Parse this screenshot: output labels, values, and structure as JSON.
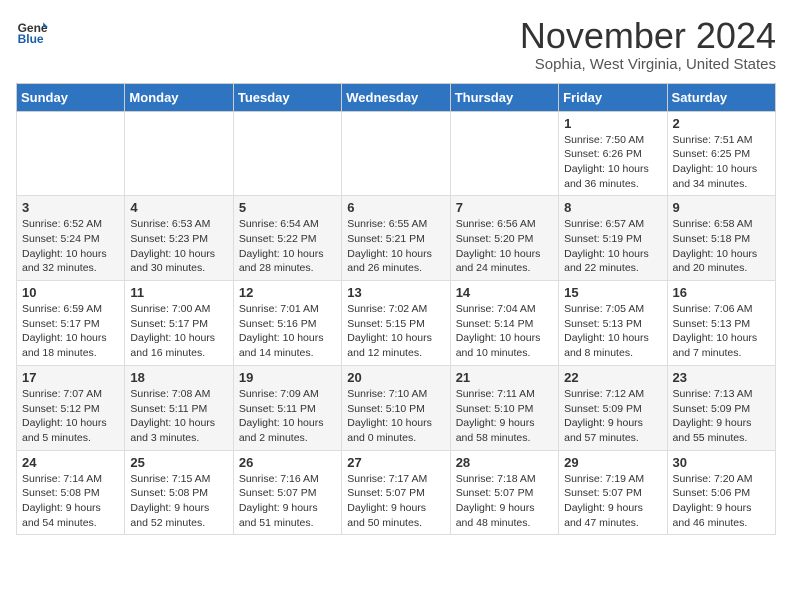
{
  "logo": {
    "general": "General",
    "blue": "Blue"
  },
  "title": "November 2024",
  "subtitle": "Sophia, West Virginia, United States",
  "days_of_week": [
    "Sunday",
    "Monday",
    "Tuesday",
    "Wednesday",
    "Thursday",
    "Friday",
    "Saturday"
  ],
  "weeks": [
    [
      {
        "day": "",
        "info": ""
      },
      {
        "day": "",
        "info": ""
      },
      {
        "day": "",
        "info": ""
      },
      {
        "day": "",
        "info": ""
      },
      {
        "day": "",
        "info": ""
      },
      {
        "day": "1",
        "info": "Sunrise: 7:50 AM\nSunset: 6:26 PM\nDaylight: 10 hours and 36 minutes."
      },
      {
        "day": "2",
        "info": "Sunrise: 7:51 AM\nSunset: 6:25 PM\nDaylight: 10 hours and 34 minutes."
      }
    ],
    [
      {
        "day": "3",
        "info": "Sunrise: 6:52 AM\nSunset: 5:24 PM\nDaylight: 10 hours and 32 minutes."
      },
      {
        "day": "4",
        "info": "Sunrise: 6:53 AM\nSunset: 5:23 PM\nDaylight: 10 hours and 30 minutes."
      },
      {
        "day": "5",
        "info": "Sunrise: 6:54 AM\nSunset: 5:22 PM\nDaylight: 10 hours and 28 minutes."
      },
      {
        "day": "6",
        "info": "Sunrise: 6:55 AM\nSunset: 5:21 PM\nDaylight: 10 hours and 26 minutes."
      },
      {
        "day": "7",
        "info": "Sunrise: 6:56 AM\nSunset: 5:20 PM\nDaylight: 10 hours and 24 minutes."
      },
      {
        "day": "8",
        "info": "Sunrise: 6:57 AM\nSunset: 5:19 PM\nDaylight: 10 hours and 22 minutes."
      },
      {
        "day": "9",
        "info": "Sunrise: 6:58 AM\nSunset: 5:18 PM\nDaylight: 10 hours and 20 minutes."
      }
    ],
    [
      {
        "day": "10",
        "info": "Sunrise: 6:59 AM\nSunset: 5:17 PM\nDaylight: 10 hours and 18 minutes."
      },
      {
        "day": "11",
        "info": "Sunrise: 7:00 AM\nSunset: 5:17 PM\nDaylight: 10 hours and 16 minutes."
      },
      {
        "day": "12",
        "info": "Sunrise: 7:01 AM\nSunset: 5:16 PM\nDaylight: 10 hours and 14 minutes."
      },
      {
        "day": "13",
        "info": "Sunrise: 7:02 AM\nSunset: 5:15 PM\nDaylight: 10 hours and 12 minutes."
      },
      {
        "day": "14",
        "info": "Sunrise: 7:04 AM\nSunset: 5:14 PM\nDaylight: 10 hours and 10 minutes."
      },
      {
        "day": "15",
        "info": "Sunrise: 7:05 AM\nSunset: 5:13 PM\nDaylight: 10 hours and 8 minutes."
      },
      {
        "day": "16",
        "info": "Sunrise: 7:06 AM\nSunset: 5:13 PM\nDaylight: 10 hours and 7 minutes."
      }
    ],
    [
      {
        "day": "17",
        "info": "Sunrise: 7:07 AM\nSunset: 5:12 PM\nDaylight: 10 hours and 5 minutes."
      },
      {
        "day": "18",
        "info": "Sunrise: 7:08 AM\nSunset: 5:11 PM\nDaylight: 10 hours and 3 minutes."
      },
      {
        "day": "19",
        "info": "Sunrise: 7:09 AM\nSunset: 5:11 PM\nDaylight: 10 hours and 2 minutes."
      },
      {
        "day": "20",
        "info": "Sunrise: 7:10 AM\nSunset: 5:10 PM\nDaylight: 10 hours and 0 minutes."
      },
      {
        "day": "21",
        "info": "Sunrise: 7:11 AM\nSunset: 5:10 PM\nDaylight: 9 hours and 58 minutes."
      },
      {
        "day": "22",
        "info": "Sunrise: 7:12 AM\nSunset: 5:09 PM\nDaylight: 9 hours and 57 minutes."
      },
      {
        "day": "23",
        "info": "Sunrise: 7:13 AM\nSunset: 5:09 PM\nDaylight: 9 hours and 55 minutes."
      }
    ],
    [
      {
        "day": "24",
        "info": "Sunrise: 7:14 AM\nSunset: 5:08 PM\nDaylight: 9 hours and 54 minutes."
      },
      {
        "day": "25",
        "info": "Sunrise: 7:15 AM\nSunset: 5:08 PM\nDaylight: 9 hours and 52 minutes."
      },
      {
        "day": "26",
        "info": "Sunrise: 7:16 AM\nSunset: 5:07 PM\nDaylight: 9 hours and 51 minutes."
      },
      {
        "day": "27",
        "info": "Sunrise: 7:17 AM\nSunset: 5:07 PM\nDaylight: 9 hours and 50 minutes."
      },
      {
        "day": "28",
        "info": "Sunrise: 7:18 AM\nSunset: 5:07 PM\nDaylight: 9 hours and 48 minutes."
      },
      {
        "day": "29",
        "info": "Sunrise: 7:19 AM\nSunset: 5:07 PM\nDaylight: 9 hours and 47 minutes."
      },
      {
        "day": "30",
        "info": "Sunrise: 7:20 AM\nSunset: 5:06 PM\nDaylight: 9 hours and 46 minutes."
      }
    ]
  ]
}
